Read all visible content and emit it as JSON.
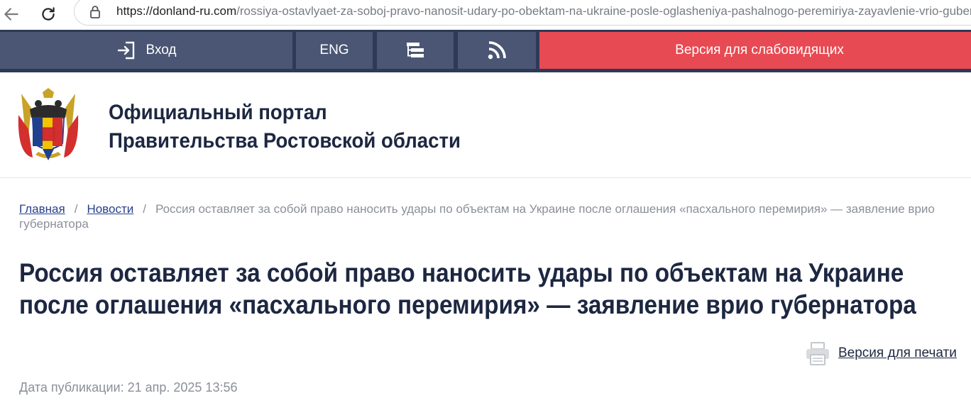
{
  "browser": {
    "url_host": "https://donland-ru.com",
    "url_path": "/rossiya-ostavlyaet-za-soboj-pravo-nanosit-udary-po-obektam-na-ukraine-posle-oglasheniya-pashalnogo-peremiriya-zayavlenie-vrio-gubernatora"
  },
  "topbar": {
    "login_label": "Вход",
    "lang_label": "ENG",
    "accessibility_label": "Версия для слабовидящих"
  },
  "header": {
    "title_line1": "Официальный портал",
    "title_line2": "Правительства Ростовской области"
  },
  "breadcrumb": {
    "home": "Главная",
    "news": "Новости",
    "current": "Россия оставляет за собой право наносить удары по объектам на Украине после оглашения «пасхального перемирия» — заявление врио губернатора"
  },
  "article": {
    "title_line1": "Россия оставляет за собой право наносить удары по объектам на Украине",
    "title_line2": "после оглашения «пасхального перемирия» — заявление врио губернатора",
    "print_label": "Версия для печати",
    "date_label": "Дата публикации:",
    "date_value": "21 апр. 2025 13:56"
  },
  "colors": {
    "topbar_bg": "#2d3a57",
    "topbar_button": "#4a5673",
    "accessibility_button": "#e74a52",
    "title_text": "#1d2741",
    "muted_text": "#8b8f99"
  }
}
